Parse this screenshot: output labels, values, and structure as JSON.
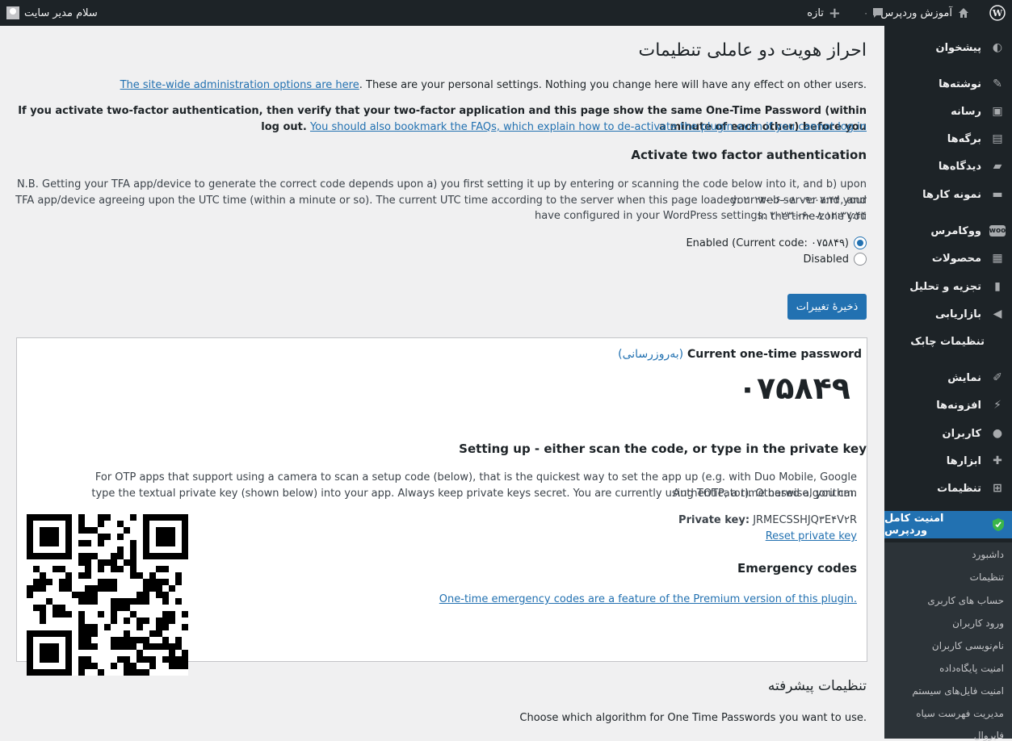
{
  "adminbar": {
    "site_name": "آموزش وردپرس",
    "comments_count": "۰",
    "new_label": "تازه",
    "account_label": "سلام مدیر سایت"
  },
  "sidebar": {
    "items": [
      {
        "label": "پیشخوان",
        "icon": "dashboard-icon"
      },
      {
        "label": "نوشته‌ها",
        "icon": "pin-icon"
      },
      {
        "label": "رسانه",
        "icon": "media-icon"
      },
      {
        "label": "برگه‌ها",
        "icon": "pages-icon"
      },
      {
        "label": "دیدگاه‌ها",
        "icon": "comments-icon"
      },
      {
        "label": "نمونه کارها",
        "icon": "folder-icon"
      },
      {
        "label": "ووکامرس",
        "icon": "woocommerce-icon"
      },
      {
        "label": "محصولات",
        "icon": "products-icon"
      },
      {
        "label": "تجزیه و تحلیل",
        "icon": "analytics-icon"
      },
      {
        "label": "بازاریابی",
        "icon": "megaphone-icon"
      },
      {
        "label": "تنظیمات چابک",
        "icon": ""
      },
      {
        "label": "نمایش",
        "icon": "appearance-icon"
      },
      {
        "label": "افزونه‌ها",
        "icon": "plugins-icon"
      },
      {
        "label": "کاربران",
        "icon": "users-icon"
      },
      {
        "label": "ابزارها",
        "icon": "tools-icon"
      },
      {
        "label": "تنظیمات",
        "icon": "settings-icon"
      },
      {
        "label": "امنیت کامل وردپرس",
        "icon": "shield-icon"
      }
    ],
    "submenu": [
      "داشبورد",
      "تنظیمات",
      "حساب های کاربری",
      "ورود کاربران",
      "نام‌نویسی کاربران",
      "امنیت پایگاه‌داده",
      "امنیت فایل‌های سیستم",
      "مدیریت فهرست سیاه",
      "فایروال"
    ]
  },
  "page": {
    "title": "احراز هویت دو عاملی تنظیمات",
    "personal_note": "These are your personal settings. Nothing you change here will have any effect on other users.",
    "personal_link": "The site-wide administration options are here",
    "warning_bold_1": "If you activate two-factor authentication, then verify that your two-factor application and this page show the same One-Time Password (within a minute of each other) before you",
    "warning_bold_2": "log out.",
    "warning_link": "You should also bookmark the FAQs, which explain how to de-activate the plugin even if you cannot log in",
    "activate_heading": "Activate two factor authentication",
    "nb_line1": "N.B. Getting your TFA app/device to generate the correct code depends upon a) you first setting it up by entering or scanning the code below into it, and b) upon your web-server and your",
    "nb_line2": "TFA app/device agreeing upon the UTC time (within a minute or so). The current UTC time according to the server when this page loaded: ۲۰۲۳-۰۶-۰۸ ۰۹:۰۷:۴۴, and in the time-zone you",
    "nb_line3": "have configured in your WordPress settings: ۲۰۲۳-۰۶-۰۸ ۱۲:۳۷:۴۴",
    "radio_enabled": "Enabled (Current code: ۰۷۵۸۴۹)",
    "radio_disabled": "Disabled",
    "save_button": "ذخیرهٔ تغییرات",
    "otp_box": {
      "title": "Current one-time password",
      "refresh_link": "(به‌روزرسانی)",
      "code": "۰۷۵۸۴۹",
      "setup_heading": "Setting up - either scan the code, or type in the private key",
      "setup_p1": "For OTP apps that support using a camera to scan a setup code (below), that is the quickest way to set the app up (e.g. with Duo Mobile, Google Authenticator). Otherwise, you can",
      "setup_p2": "type the textual private key (shown below) into your app. Always keep private keys secret. You are currently using TOTP, a time based algorithm.",
      "private_key_label": "Private key:",
      "private_key_value": "JRMECSSHJQ۳E۴V۲R",
      "reset_link": "Reset private key",
      "emergency_heading": "Emergency codes",
      "emergency_link": "One-time emergency codes are a feature of the Premium version of this plugin."
    },
    "advanced_heading": "تنظیمات پیشرفته",
    "algorithm_note": "Choose which algorithm for One Time Passwords you want to use."
  }
}
